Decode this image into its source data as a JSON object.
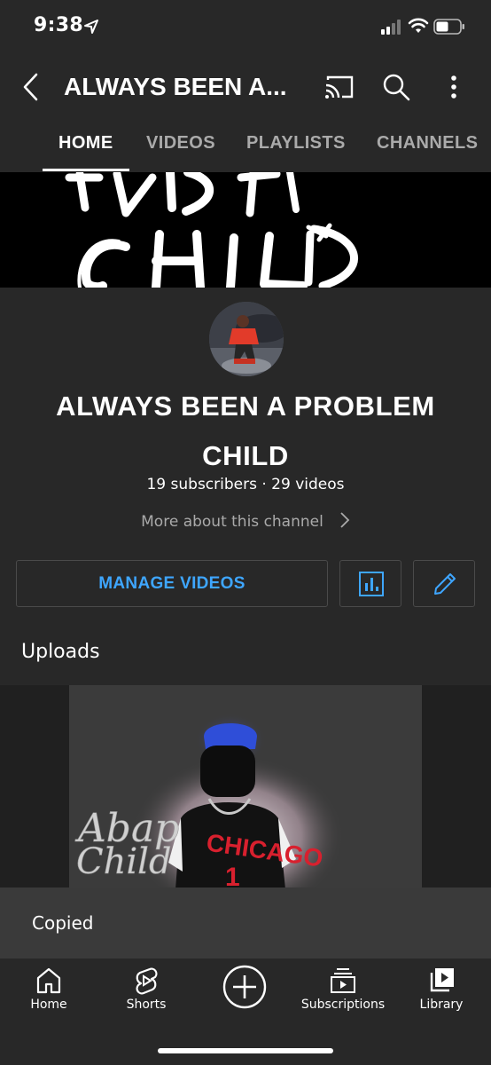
{
  "status_bar": {
    "time": "9:38"
  },
  "header": {
    "title": "ALWAYS BEEN A..."
  },
  "tabs": [
    {
      "label": "HOME",
      "active": true
    },
    {
      "label": "VIDEOS",
      "active": false
    },
    {
      "label": "PLAYLISTS",
      "active": false
    },
    {
      "label": "CHANNELS",
      "active": false
    }
  ],
  "banner": {
    "art_text": "ABAP CHILD"
  },
  "channel": {
    "name_line1": "ALWAYS BEEN A PROBLEM",
    "name_line2": "CHILD",
    "stats": "19 subscribers · 29 videos",
    "more_about": "More about this channel"
  },
  "actions": {
    "manage_videos": "MANAGE VIDEOS"
  },
  "uploads": {
    "title": "Uploads",
    "thumbnail_text_line1": "Abap",
    "thumbnail_text_line2": "Child",
    "jersey_text": "CHICAGO",
    "jersey_number": "1"
  },
  "toast": {
    "text": "Copied"
  },
  "bottom_nav": [
    {
      "label": "Home",
      "icon": "home-icon"
    },
    {
      "label": "Shorts",
      "icon": "shorts-icon"
    },
    {
      "label": "",
      "icon": "create-icon"
    },
    {
      "label": "Subscriptions",
      "icon": "subscriptions-icon"
    },
    {
      "label": "Library",
      "icon": "library-icon"
    }
  ],
  "colors": {
    "background": "#282828",
    "accent_blue": "#3ea6ff",
    "secondary_text": "#aaaaaa",
    "toast_bg": "#3a3a3a"
  }
}
